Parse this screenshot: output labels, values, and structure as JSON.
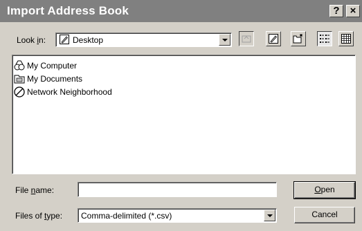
{
  "window": {
    "title": "Import Address Book",
    "help_glyph": "?",
    "close_glyph": "×"
  },
  "lookin": {
    "label_pre": "Look ",
    "label_accel": "i",
    "label_post": "n:",
    "value": "Desktop",
    "icon": "desktop-icon"
  },
  "toolbar": {
    "buttons": [
      "up-one-level-icon",
      "desktop-shortcut-icon",
      "new-folder-icon",
      "list-view-icon",
      "details-view-icon"
    ]
  },
  "files": [
    {
      "label": "My Computer",
      "icon": "my-computer-icon"
    },
    {
      "label": "My Documents",
      "icon": "my-documents-icon"
    },
    {
      "label": "Network Neighborhood",
      "icon": "network-neighborhood-icon"
    }
  ],
  "filename": {
    "label_pre": "File ",
    "label_accel": "n",
    "label_post": "ame:",
    "value": "",
    "placeholder": ""
  },
  "filetype": {
    "label_pre": "Files of ",
    "label_accel": "t",
    "label_post": "ype:",
    "value": "Comma-delimited (*.csv)"
  },
  "buttons": {
    "open_accel": "O",
    "open_rest": "pen",
    "cancel": "Cancel"
  }
}
